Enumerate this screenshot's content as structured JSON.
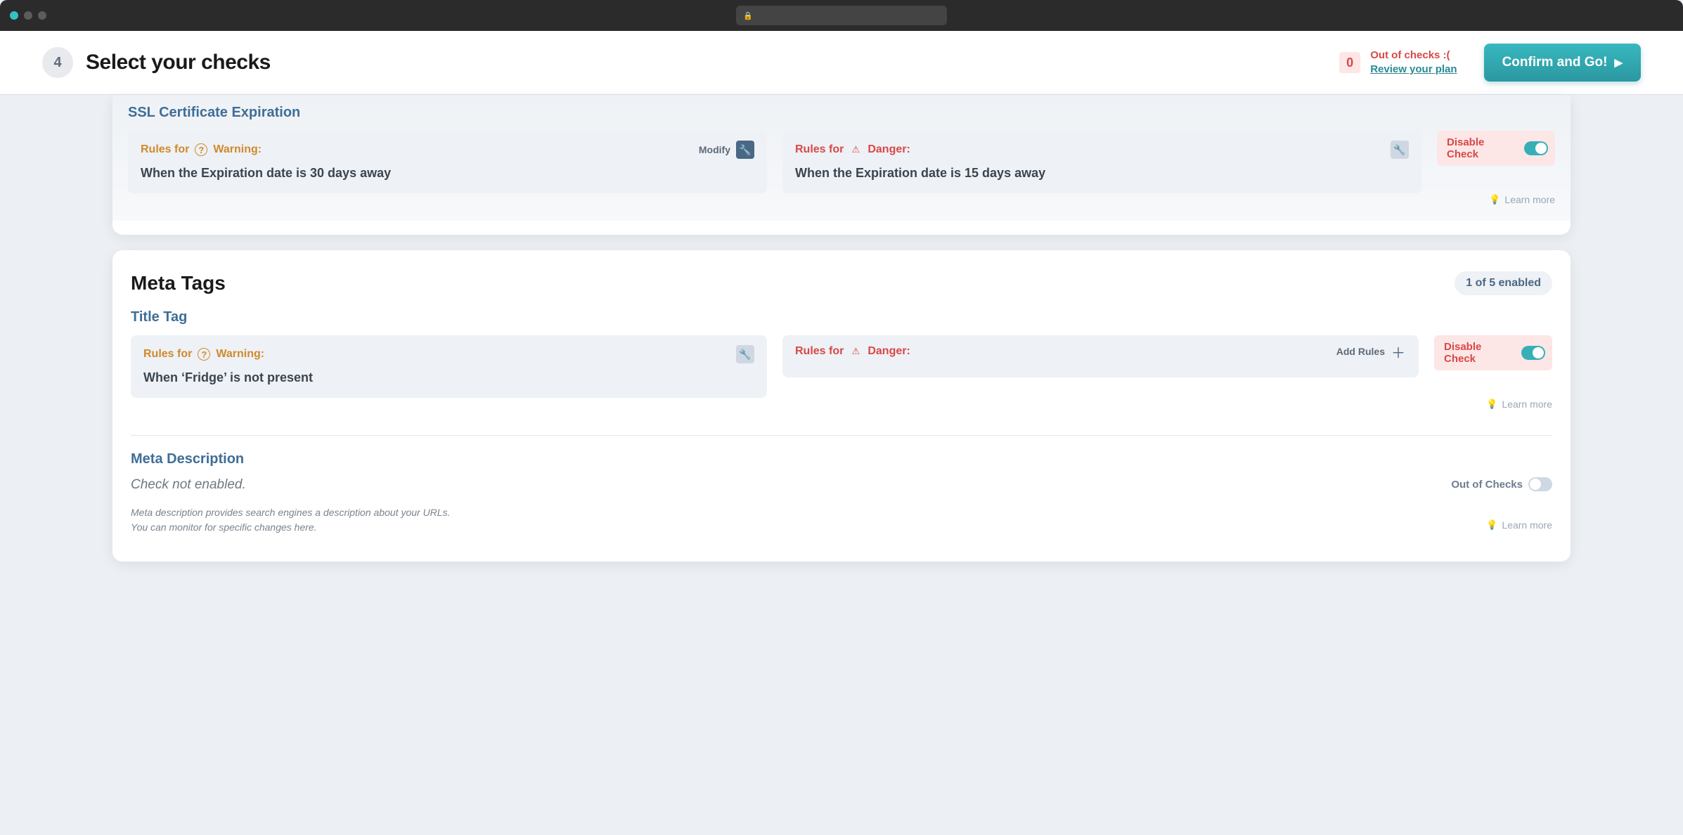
{
  "chrome": {
    "traffic": [
      "r",
      "y",
      "g"
    ]
  },
  "header": {
    "step": "4",
    "title": "Select your checks",
    "counter": {
      "count": "0",
      "line1": "Out of checks :(",
      "link": "Review your plan"
    },
    "confirm": "Confirm and Go!"
  },
  "ssl": {
    "title": "SSL Certificate Expiration",
    "warning": {
      "rules_for": "Rules for",
      "label": "Warning:",
      "modify": "Modify",
      "body": "When the Expiration date is 30 days away"
    },
    "danger": {
      "rules_for": "Rules for",
      "label": "Danger:",
      "body": "When the Expiration date is 15 days away"
    },
    "disable": "Disable Check",
    "learn": "Learn more"
  },
  "meta": {
    "title": "Meta Tags",
    "chip": "1 of 5 enabled",
    "titletag": {
      "title": "Title Tag",
      "warning": {
        "rules_for": "Rules for",
        "label": "Warning:",
        "body": "When ‘Fridge’ is not present"
      },
      "danger": {
        "rules_for": "Rules for",
        "label": "Danger:",
        "add": "Add Rules"
      },
      "disable": "Disable Check",
      "learn": "Learn more"
    },
    "metadesc": {
      "title": "Meta Description",
      "not_enabled": "Check not enabled.",
      "desc1": "Meta description provides search engines a description about your URLs.",
      "desc2": "You can monitor for specific changes here.",
      "out": "Out of Checks",
      "learn": "Learn more"
    }
  }
}
